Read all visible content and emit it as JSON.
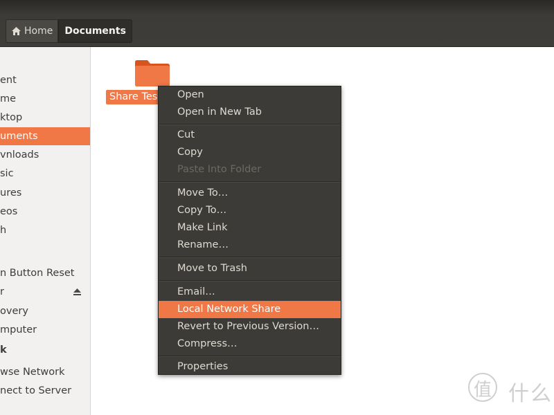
{
  "pathbar": {
    "home_label": "Home",
    "current_label": "Documents"
  },
  "sidebar": {
    "items": [
      {
        "label": "ent"
      },
      {
        "label": "me"
      },
      {
        "label": "ktop"
      },
      {
        "label": "uments",
        "selected": true
      },
      {
        "label": "vnloads"
      },
      {
        "label": "sic"
      },
      {
        "label": "ures"
      },
      {
        "label": "eos"
      },
      {
        "label": "h"
      },
      {
        "label": "n Button Reset"
      },
      {
        "label": "r",
        "icon": "eject-icon"
      },
      {
        "label": "overy"
      },
      {
        "label": "mputer"
      },
      {
        "label": "k",
        "heading": true
      },
      {
        "label": "wse Network"
      },
      {
        "label": "nect to Server"
      }
    ]
  },
  "main": {
    "folder": {
      "name": "Share Tes",
      "icon": "folder-icon",
      "color": "#f07746"
    }
  },
  "context_menu": {
    "items": [
      {
        "label": "Open"
      },
      {
        "label": "Open in New Tab"
      },
      {
        "label": "Cut"
      },
      {
        "label": "Copy"
      },
      {
        "label": "Paste Into Folder",
        "disabled": true
      },
      {
        "label": "Move To…"
      },
      {
        "label": "Copy To…"
      },
      {
        "label": "Make Link"
      },
      {
        "label": "Rename…"
      },
      {
        "label": "Move to Trash"
      },
      {
        "label": "Email…"
      },
      {
        "label": "Local Network Share",
        "highlighted": true
      },
      {
        "label": "Revert to Previous Version…"
      },
      {
        "label": "Compress…"
      },
      {
        "label": "Properties"
      }
    ]
  },
  "watermark": {
    "glyph": "值",
    "text": "什么"
  },
  "colors": {
    "accent": "#f07746",
    "header_bg": "#3c3b37",
    "menu_bg": "#3c3b37",
    "sidebar_bg": "#f2f1f0"
  }
}
